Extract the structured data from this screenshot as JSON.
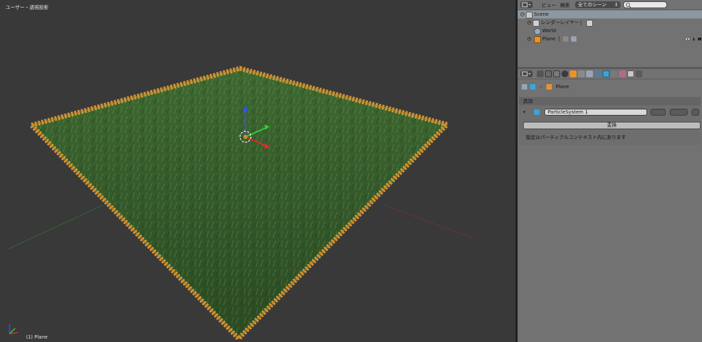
{
  "viewport": {
    "view_label": "ユーザー・透視投影",
    "object_label": "(1) Plane"
  },
  "outliner": {
    "menu": [
      "ビュー",
      "検索"
    ],
    "scene_select": "全てのシーン",
    "search_placeholder": "",
    "rows": [
      {
        "label": "Scene"
      },
      {
        "label": "レンダーレイヤー"
      },
      {
        "label": "World"
      },
      {
        "label": "Plane"
      }
    ]
  },
  "properties": {
    "breadcrumb": "Plane",
    "panel_title": "追加",
    "particle_system": "ParticleSystem 1",
    "convert_button": "変換",
    "note": "設定はパーティクルコンテキスト内にあります"
  },
  "colors": {
    "grass_dark": "#2f4f24",
    "grass_light": "#4d7a3a",
    "tips": "#e2a13a",
    "selected_row": "#8c97a0"
  }
}
